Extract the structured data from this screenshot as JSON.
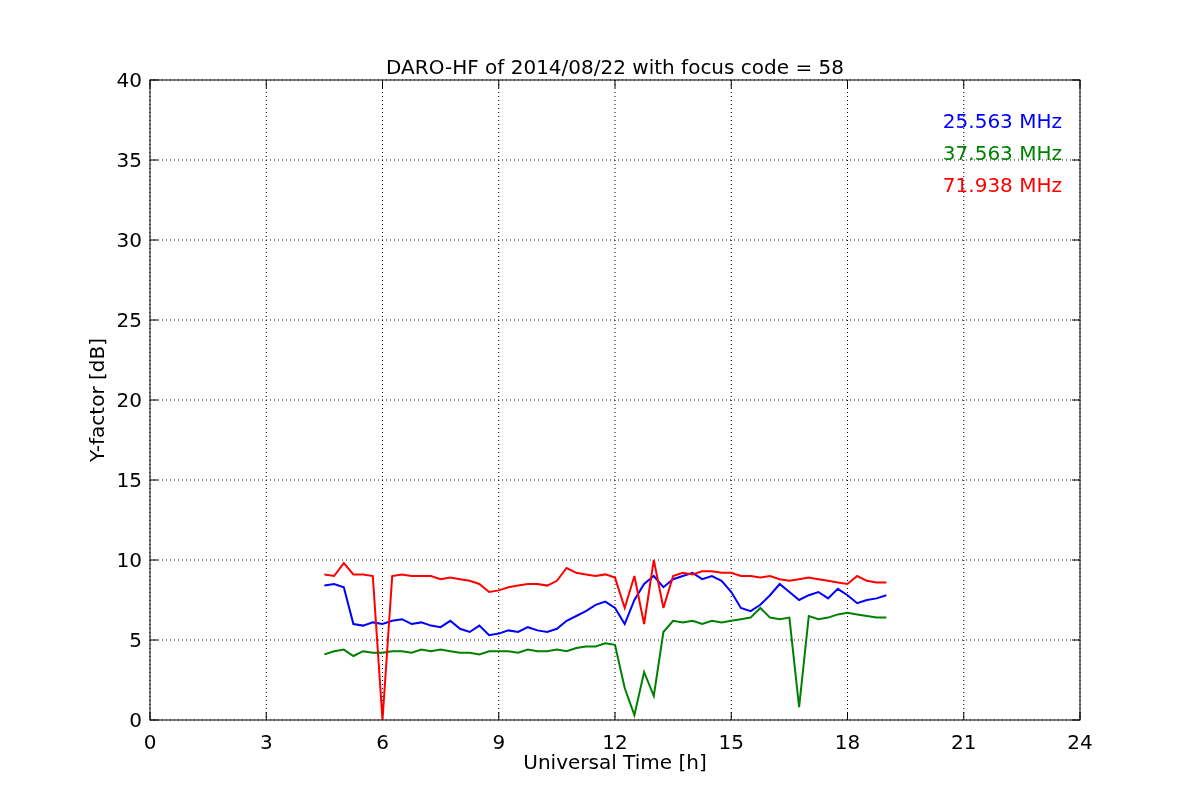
{
  "chart_data": {
    "type": "line",
    "grid": true,
    "title": "DARO-HF of 2014/08/22 with focus code = 58",
    "xlabel": "Universal Time [h]",
    "ylabel": "Y-factor [dB]",
    "xlim": [
      0,
      24
    ],
    "ylim": [
      0,
      40
    ],
    "xticks": [
      0,
      3,
      6,
      9,
      12,
      15,
      18,
      21,
      24
    ],
    "yticks": [
      0,
      5,
      10,
      15,
      20,
      25,
      30,
      35,
      40
    ],
    "x": [
      4.5,
      4.75,
      5,
      5.25,
      5.5,
      5.75,
      6,
      6.25,
      6.5,
      6.75,
      7,
      7.25,
      7.5,
      7.75,
      8,
      8.25,
      8.5,
      8.75,
      9,
      9.25,
      9.5,
      9.75,
      10,
      10.25,
      10.5,
      10.75,
      11,
      11.25,
      11.5,
      11.75,
      12,
      12.25,
      12.5,
      12.75,
      13,
      13.25,
      13.5,
      13.75,
      14,
      14.25,
      14.5,
      14.75,
      15,
      15.25,
      15.5,
      15.75,
      16,
      16.25,
      16.5,
      16.75,
      17,
      17.25,
      17.5,
      17.75,
      18,
      18.25,
      18.5,
      18.75,
      19
    ],
    "series": [
      {
        "name": "25.563 MHz",
        "color": "#0000ff",
        "values": [
          8.4,
          8.5,
          8.3,
          6.0,
          5.9,
          6.1,
          6.0,
          6.2,
          6.3,
          6.0,
          6.1,
          5.9,
          5.8,
          6.2,
          5.7,
          5.5,
          5.9,
          5.3,
          5.4,
          5.6,
          5.5,
          5.8,
          5.6,
          5.5,
          5.7,
          6.2,
          6.5,
          6.8,
          7.2,
          7.4,
          7.0,
          6.0,
          7.5,
          8.5,
          9.0,
          8.3,
          8.8,
          9.0,
          9.2,
          8.8,
          9.0,
          8.7,
          8.0,
          7.0,
          6.8,
          7.2,
          7.8,
          8.5,
          8.0,
          7.5,
          7.8,
          8.0,
          7.6,
          8.2,
          7.8,
          7.3,
          7.5,
          7.6,
          7.8
        ]
      },
      {
        "name": "37.563 MHz",
        "color": "#008000",
        "values": [
          4.1,
          4.3,
          4.4,
          4.0,
          4.3,
          4.2,
          4.2,
          4.3,
          4.3,
          4.2,
          4.4,
          4.3,
          4.4,
          4.3,
          4.2,
          4.2,
          4.1,
          4.3,
          4.3,
          4.3,
          4.2,
          4.4,
          4.3,
          4.3,
          4.4,
          4.3,
          4.5,
          4.6,
          4.6,
          4.8,
          4.7,
          2.0,
          0.3,
          3.0,
          1.5,
          5.5,
          6.2,
          6.1,
          6.2,
          6.0,
          6.2,
          6.1,
          6.2,
          6.3,
          6.4,
          7.0,
          6.4,
          6.3,
          6.4,
          0.8,
          6.5,
          6.3,
          6.4,
          6.6,
          6.7,
          6.6,
          6.5,
          6.4,
          6.4
        ]
      },
      {
        "name": "71.938 MHz",
        "color": "#ff0000",
        "values": [
          9.1,
          9.0,
          9.8,
          9.1,
          9.1,
          9.0,
          0,
          9.0,
          9.1,
          9.0,
          9.0,
          9.0,
          8.8,
          8.9,
          8.8,
          8.7,
          8.5,
          8.0,
          8.1,
          8.3,
          8.4,
          8.5,
          8.5,
          8.4,
          8.7,
          9.5,
          9.2,
          9.1,
          9.0,
          9.1,
          8.9,
          7.0,
          9.0,
          6.0,
          10.0,
          7.0,
          9.0,
          9.2,
          9.1,
          9.3,
          9.3,
          9.2,
          9.2,
          9.0,
          9.0,
          8.9,
          9.0,
          8.8,
          8.7,
          8.8,
          8.9,
          8.8,
          8.7,
          8.6,
          8.5,
          9.0,
          8.7,
          8.6,
          8.6
        ]
      }
    ]
  }
}
